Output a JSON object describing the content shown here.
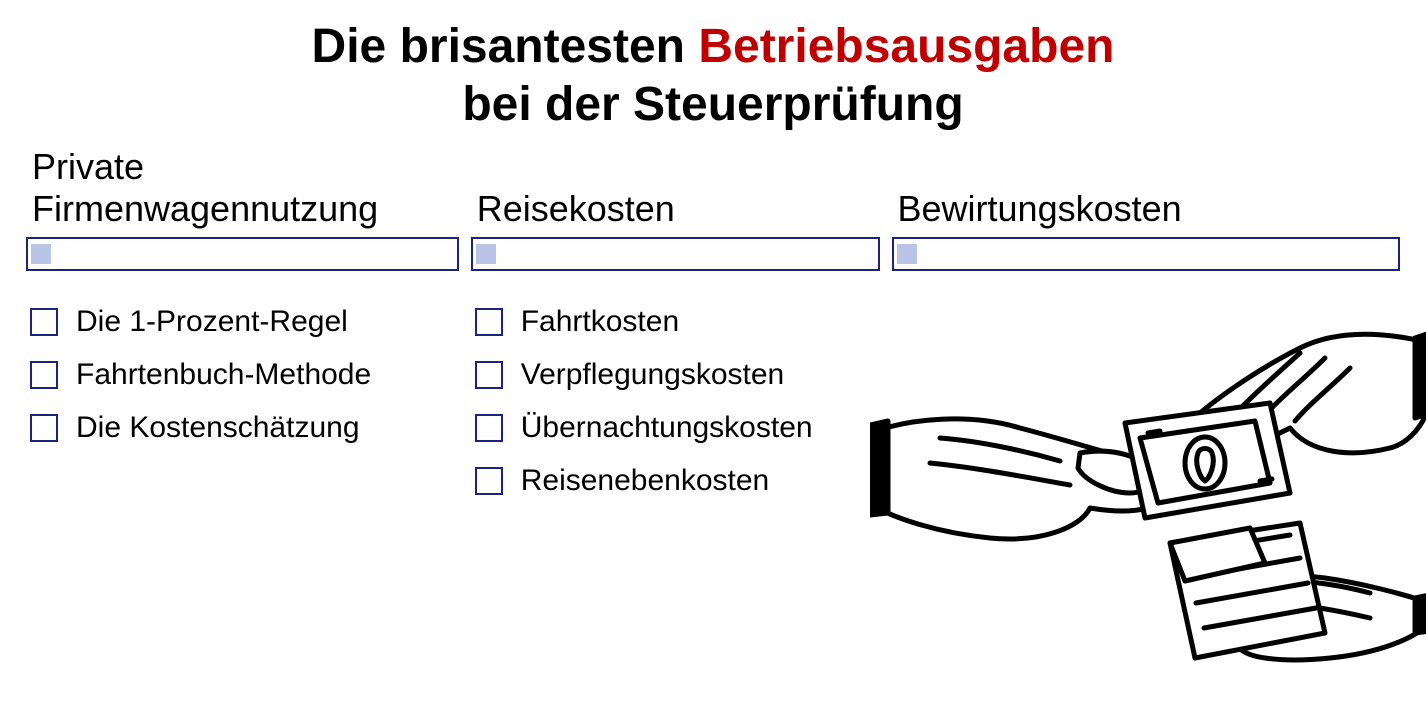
{
  "accent_color": "#c00000",
  "border_color": "#1a237e",
  "fill_color": "#b9c3e6",
  "title": {
    "part1": "Die brisantesten ",
    "accent": "Betriebsausgaben",
    "part2": "bei der Steuerprüfung"
  },
  "columns": [
    {
      "header": "Private Firmenwagennutzung",
      "items": [
        "Die 1-Prozent-Regel",
        "Fahrtenbuch-Methode",
        "Die Kostenschätzung"
      ]
    },
    {
      "header": "Reisekosten",
      "items": [
        "Fahrtkosten",
        "Verpflegungskosten",
        "Übernachtungskosten",
        "Reisenebenkosten"
      ]
    },
    {
      "header": "Bewirtungskosten",
      "items": []
    }
  ],
  "illustration_name": "hands-exchanging-money-icon"
}
